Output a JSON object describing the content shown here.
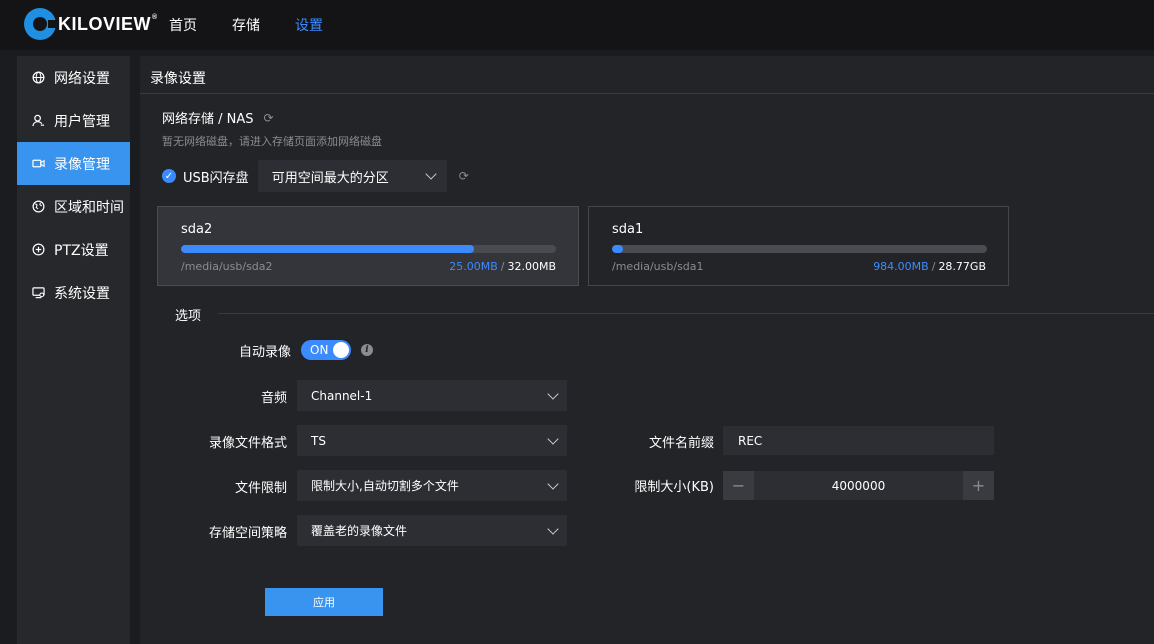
{
  "brand": {
    "logo_text": "KILOVIEW",
    "reg_mark": "®"
  },
  "top_nav": [
    {
      "label": "首页",
      "active": false
    },
    {
      "label": "存储",
      "active": false
    },
    {
      "label": "设置",
      "active": true
    }
  ],
  "sidebar": {
    "items": [
      {
        "label": "网络设置",
        "icon": "globe-icon"
      },
      {
        "label": "用户管理",
        "icon": "user-icon"
      },
      {
        "label": "录像管理",
        "icon": "camera-icon",
        "active": true
      },
      {
        "label": "区域和时间",
        "icon": "clock-icon"
      },
      {
        "label": "PTZ设置",
        "icon": "ptz-icon"
      },
      {
        "label": "系统设置",
        "icon": "monitor-icon"
      }
    ]
  },
  "page": {
    "title": "录像设置",
    "nas": {
      "title": "网络存储 / NAS",
      "hint": "暂无网络磁盘，请进入存储页面添加网络磁盘"
    },
    "usb": {
      "label": "USB闪存盘",
      "checked": true,
      "partition_select": "可用空间最大的分区"
    },
    "disks": [
      {
        "name": "sda2",
        "path": "/media/usb/sda2",
        "used": "25.00MB",
        "total": "32.00MB",
        "usage_percent": 78,
        "selected": true
      },
      {
        "name": "sda1",
        "path": "/media/usb/sda1",
        "used": "984.00MB",
        "total": "28.77GB",
        "usage_percent": 3,
        "selected": false
      }
    ],
    "options": {
      "section_title": "选项",
      "auto_record": {
        "label": "自动录像",
        "state": "ON"
      },
      "audio": {
        "label": "音频",
        "value": "Channel-1"
      },
      "file_format": {
        "label": "录像文件格式",
        "value": "TS"
      },
      "file_limit": {
        "label": "文件限制",
        "value": "限制大小,自动切割多个文件"
      },
      "storage_policy": {
        "label": "存储空间策略",
        "value": "覆盖老的录像文件"
      },
      "filename_prefix": {
        "label": "文件名前缀",
        "value": "REC"
      },
      "size_limit": {
        "label": "限制大小(KB)",
        "value": "4000000",
        "minus": "−",
        "plus": "+"
      }
    },
    "apply_label": "应用"
  },
  "colors": {
    "accent": "#3b8bff",
    "active_sidebar": "#3994f0",
    "background": "#1b1c20"
  }
}
